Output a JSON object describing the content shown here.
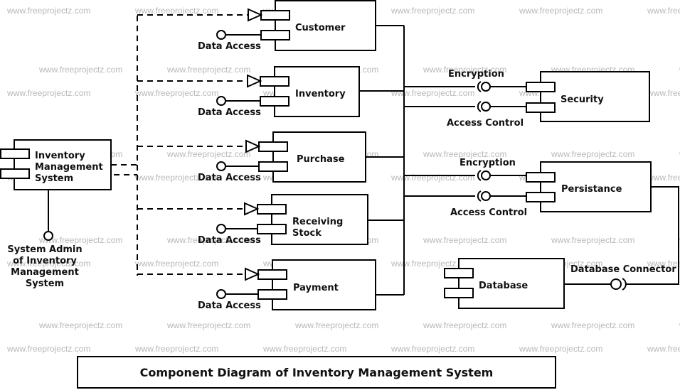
{
  "diagram": {
    "title": "Component Diagram of Inventory Management System",
    "watermark": "www.freeprojectz.com",
    "main_component": {
      "label_lines": [
        "Inventory",
        "Management",
        "System"
      ],
      "interface_label_lines": [
        "System Admin",
        "of Inventory",
        "Management",
        "System"
      ]
    },
    "modules": [
      {
        "name": "Customer",
        "label_lines": [
          "Customer"
        ],
        "interface": "Data Access"
      },
      {
        "name": "Inventory",
        "label_lines": [
          "Inventory"
        ],
        "interface": "Data Access"
      },
      {
        "name": "Purchase",
        "label_lines": [
          "Purchase"
        ],
        "interface": "Data Access"
      },
      {
        "name": "Receiving Stock",
        "label_lines": [
          "Receiving",
          "Stock"
        ],
        "interface": "Data Access"
      },
      {
        "name": "Payment",
        "label_lines": [
          "Payment"
        ],
        "interface": "Data Access"
      }
    ],
    "services": [
      {
        "name": "Security",
        "interfaces": [
          "Encryption",
          "Access Control"
        ]
      },
      {
        "name": "Persistance",
        "interfaces": [
          "Encryption",
          "Access Control"
        ]
      }
    ],
    "database": {
      "name": "Database",
      "interface": "Database Connector"
    }
  }
}
